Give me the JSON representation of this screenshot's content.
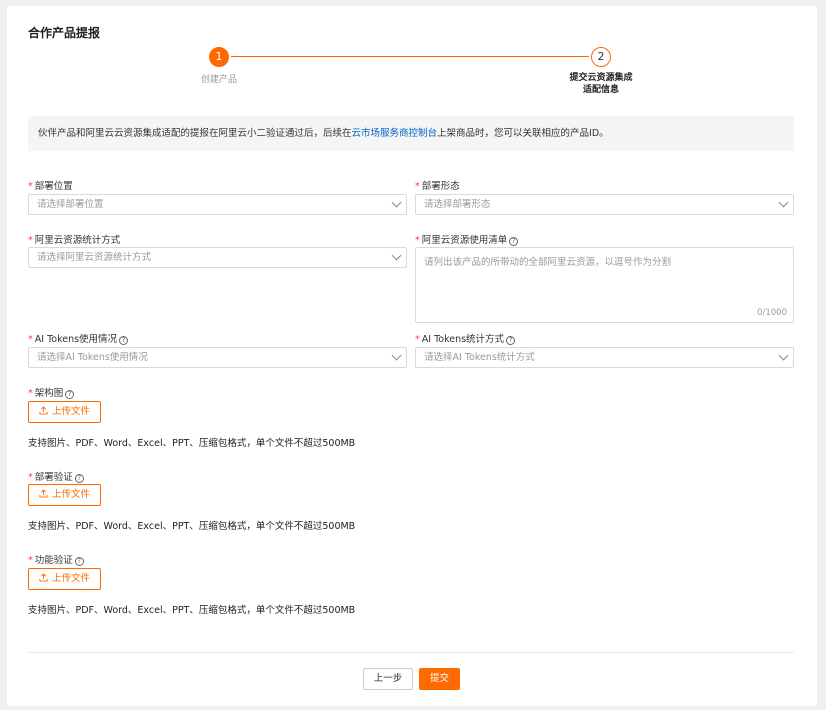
{
  "page": {
    "title": "合作产品提报"
  },
  "steps": [
    {
      "number": "1",
      "label": "创建产品"
    },
    {
      "number": "2",
      "label_line1": "提交云资源集成",
      "label_line2": "适配信息"
    }
  ],
  "notice": {
    "text_before": "伙伴产品和阿里云云资源集成适配的提报在阿里云小二验证通过后，后续在",
    "link": "云市场服务商控制台",
    "text_after": "上架商品时，您可以关联相应的产品ID。"
  },
  "fields": {
    "deploy_location": {
      "label": "部署位置",
      "placeholder": "请选择部署位置"
    },
    "deploy_form": {
      "label": "部署形态",
      "placeholder": "请选择部署形态"
    },
    "aliyun_stat_method": {
      "label": "阿里云资源统计方式",
      "placeholder": "请选择阿里云资源统计方式"
    },
    "aliyun_resource_list": {
      "label": "阿里云资源使用清单",
      "placeholder": "请列出该产品的所带动的全部阿里云资源，以逗号作为分割",
      "counter": "0/1000"
    },
    "ai_tokens_usage": {
      "label": "AI Tokens使用情况",
      "placeholder": "请选择AI Tokens使用情况"
    },
    "ai_tokens_stat": {
      "label": "AI Tokens统计方式",
      "placeholder": "请选择AI Tokens统计方式"
    }
  },
  "uploads": [
    {
      "label": "架构图",
      "button": "上传文件",
      "hint": "支持图片、PDF、Word、Excel、PPT、压缩包格式，单个文件不超过500MB"
    },
    {
      "label": "部署验证",
      "button": "上传文件",
      "hint": "支持图片、PDF、Word、Excel、PPT、压缩包格式，单个文件不超过500MB"
    },
    {
      "label": "功能验证",
      "button": "上传文件",
      "hint": "支持图片、PDF、Word、Excel、PPT、压缩包格式，单个文件不超过500MB"
    }
  ],
  "footer": {
    "prev": "上一步",
    "submit": "提交"
  },
  "required_mark": "*",
  "help_mark": "?",
  "icons": {
    "help": "question-circle-icon",
    "upload": "upload-icon",
    "dropdown": "chevron-down-icon"
  },
  "colors": {
    "accent": "#ff6a00",
    "link": "#0064c8",
    "required": "#ff3b30",
    "notice_bg": "#f5f5f5"
  }
}
